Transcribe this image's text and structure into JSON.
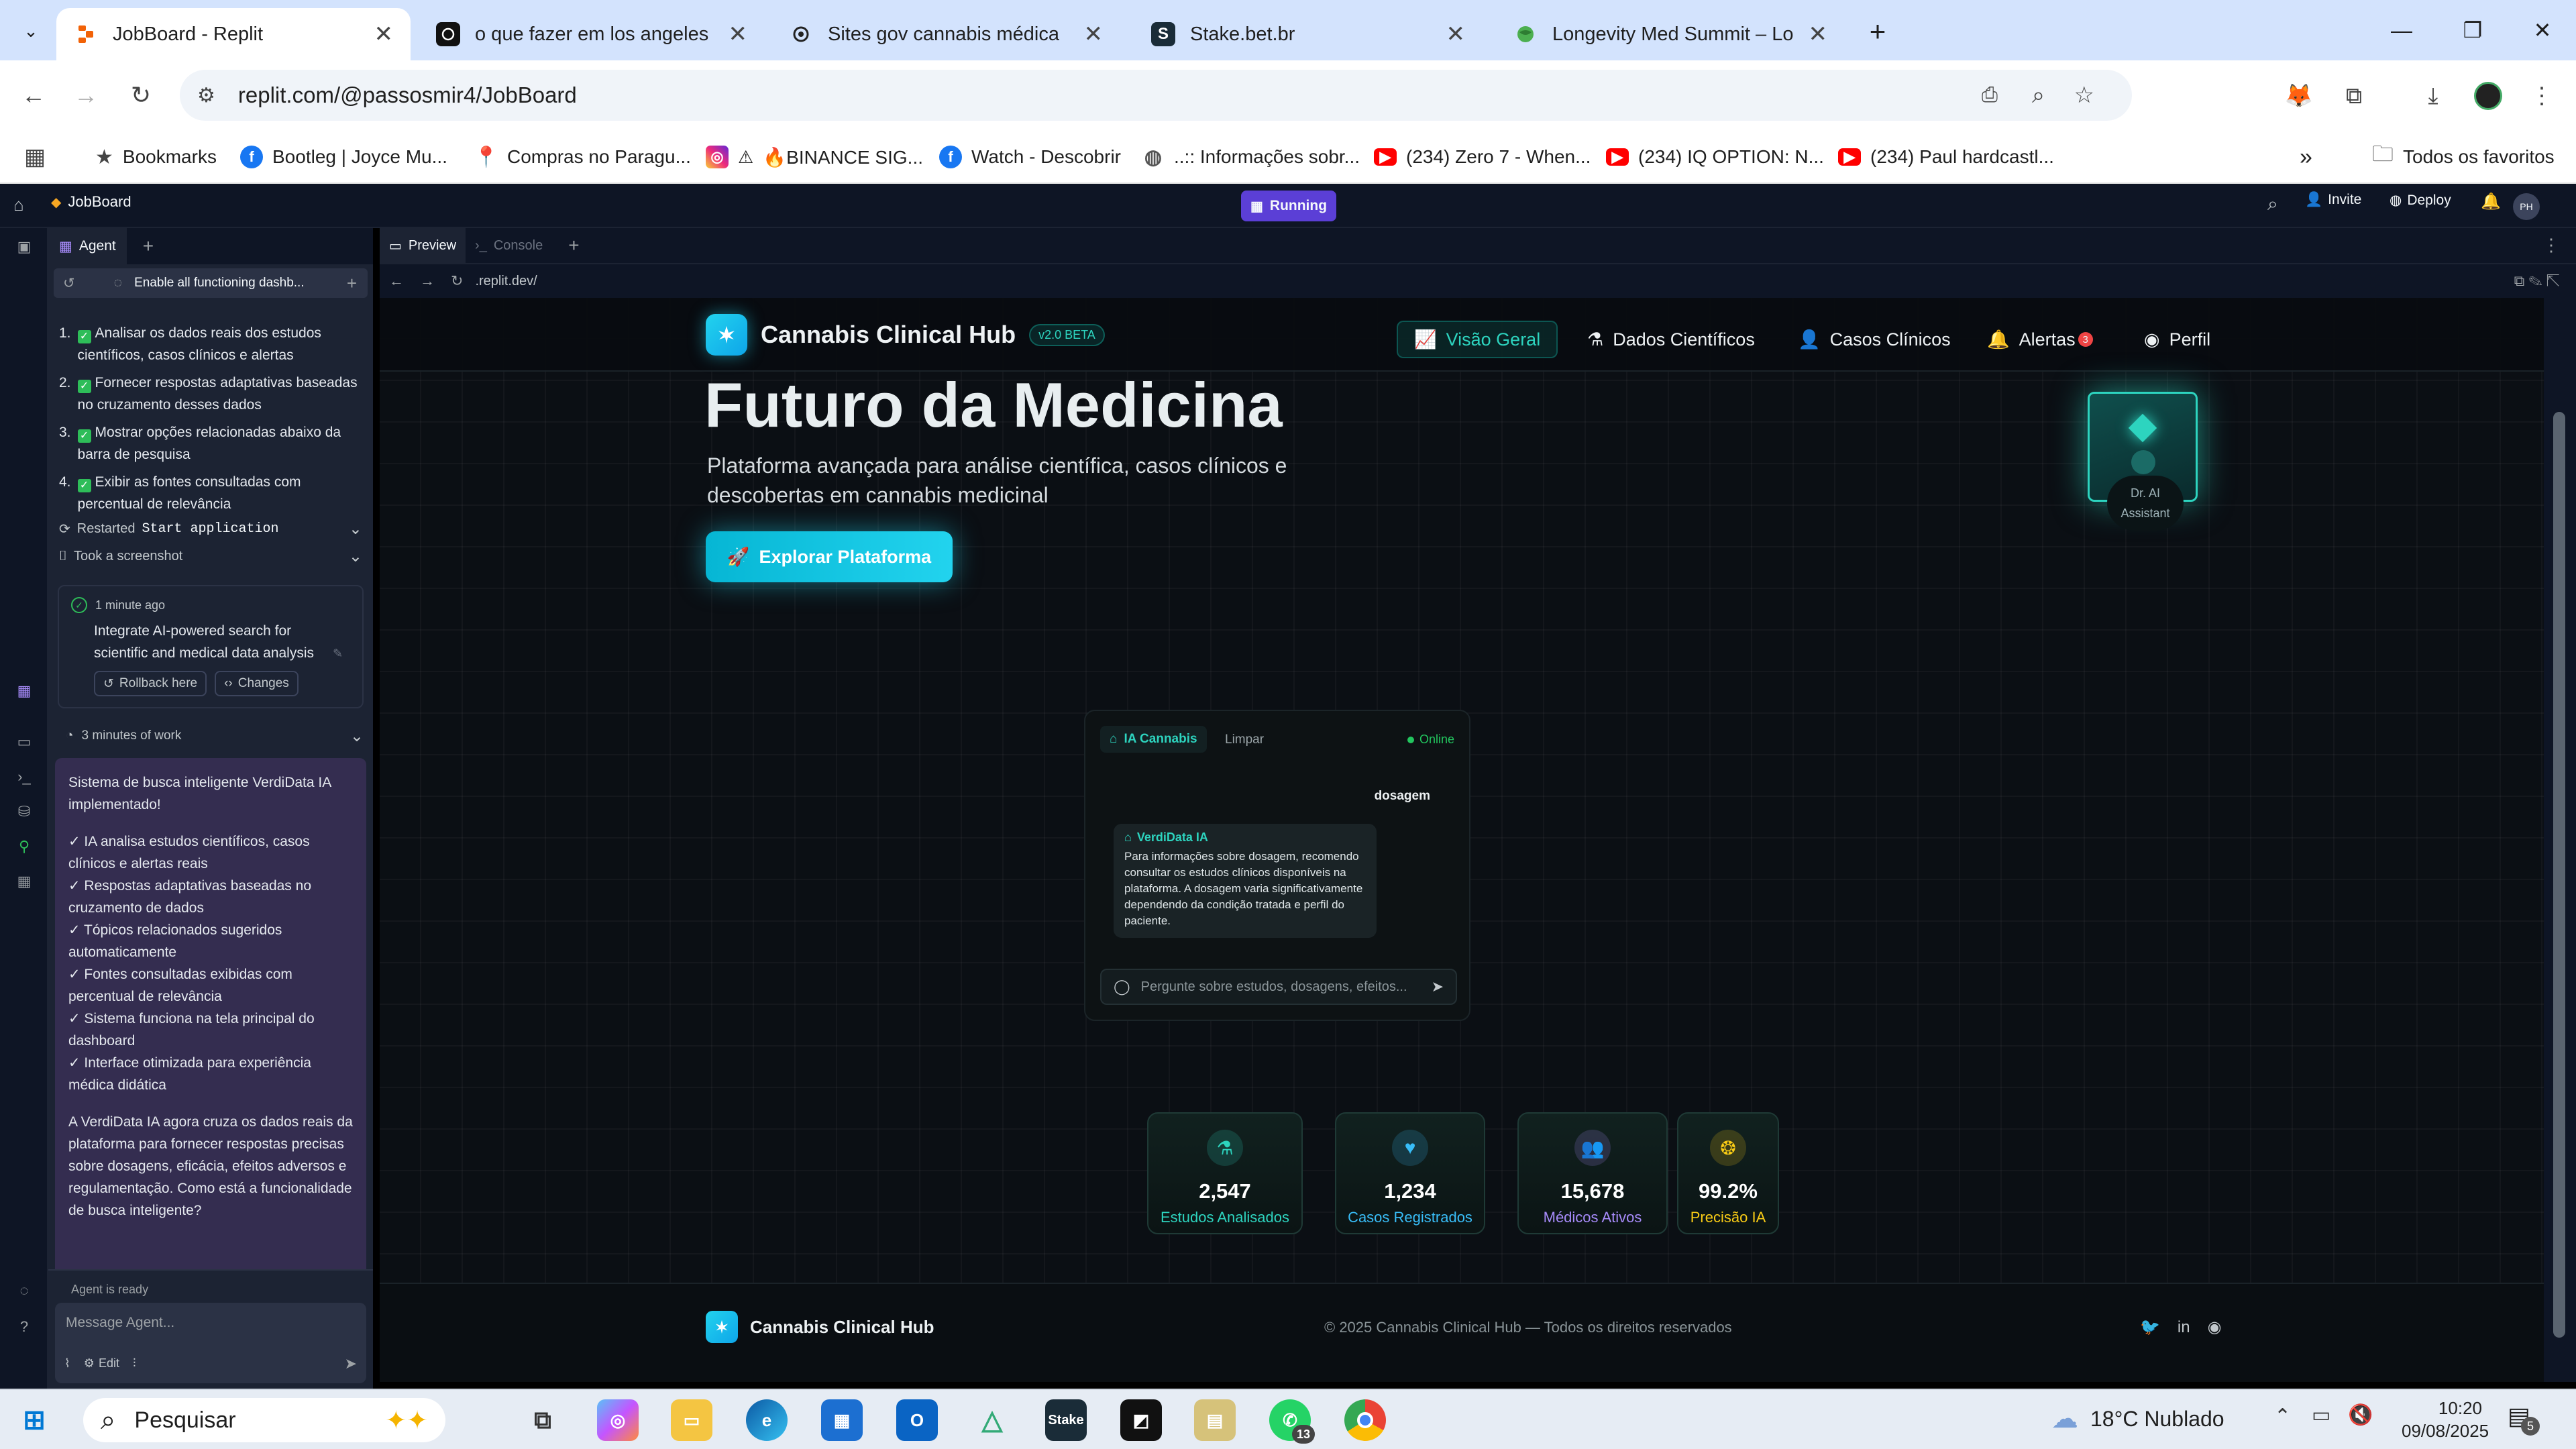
{
  "browser": {
    "tabs": [
      {
        "title": "JobBoard - Replit",
        "active": true
      },
      {
        "title": "o que fazer em los angeles",
        "active": false
      },
      {
        "title": "Sites gov cannabis médica",
        "active": false
      },
      {
        "title": "Stake.bet.br",
        "active": false
      },
      {
        "title": "Longevity Med Summit – Longevity",
        "active": false
      }
    ],
    "url": "replit.com/@passosmir4/JobBoard",
    "bookmarks": [
      "Bookmarks",
      "Bootleg | Joyce Mu...",
      "Compras no Paragu...",
      "🔥BINANCE SIG...",
      "Watch - Descobrir",
      "..:: Informações sobr...",
      "(234) Zero 7 - When...",
      "(234) IQ OPTION: N...",
      "(234) Paul hardcastl..."
    ],
    "all_bookmarks": "Todos os favoritos"
  },
  "replit": {
    "project": "JobBoard",
    "status": "Running",
    "invite": "Invite",
    "deploy": "Deploy",
    "avatar_initials": "PH",
    "agent_tab": "Agent",
    "thread_title": "Enable all functioning dashb...",
    "checklist": [
      "Analisar os dados reais dos estudos científicos, casos clínicos e alertas",
      "Fornecer respostas adaptativas baseadas no cruzamento desses dados",
      "Mostrar opções relacionadas abaixo da barra de pesquisa",
      "Exibir as fontes consultadas com percentual de relevância"
    ],
    "restarted_prefix": "Restarted",
    "restarted_cmd": "Start application",
    "screenshot_label": "Took a screenshot",
    "checkpoint": {
      "time": "1 minute ago",
      "text": "Integrate AI-powered search for scientific and medical data analysis",
      "rollback": "Rollback here",
      "changes": "Changes"
    },
    "work_time": "3 minutes of work",
    "message": {
      "intro": "Sistema de busca inteligente VerdiData IA implementado!",
      "bullets": [
        "✓ IA analisa estudos científicos, casos clínicos e alertas reais",
        "✓ Respostas adaptativas baseadas no cruzamento de dados",
        "✓ Tópicos relacionados sugeridos automaticamente",
        "✓ Fontes consultadas exibidas com percentual de relevância",
        "✓ Sistema funciona na tela principal do dashboard",
        "✓ Interface otimizada para experiência médica didática"
      ],
      "outro": "A VerdiData IA agora cruza os dados reais da plataforma para fornecer respostas precisas sobre dosagens, eficácia, efeitos adversos e regulamentação. Como está a funcionalidade de busca inteligente?"
    },
    "agent_ready": "Agent is ready",
    "message_placeholder": "Message Agent...",
    "edit_label": "Edit",
    "workspace_tabs": [
      "Preview",
      "Console"
    ],
    "preview_url": ".replit.dev/"
  },
  "site": {
    "brand": "Cannabis Clinical Hub",
    "version": "v2.0 BETA",
    "nav": [
      {
        "label": "Visão Geral",
        "icon": "chart-line-icon",
        "active": true
      },
      {
        "label": "Dados Científicos",
        "icon": "flask-icon",
        "active": false
      },
      {
        "label": "Casos Clínicos",
        "icon": "user-icon",
        "active": false
      },
      {
        "label": "Alertas",
        "icon": "bell-icon",
        "active": false,
        "badge": "3"
      },
      {
        "label": "Perfil",
        "icon": "user-circle-icon",
        "active": false
      }
    ],
    "hero_title": "Futuro da Medicina",
    "hero_subtitle_1": "Plataforma avançada para análise científica, casos clínicos e",
    "hero_subtitle_2": "descobertas em cannabis medicinal",
    "cta": "Explorar Plataforma",
    "assistant_line1": "Dr. AI",
    "assistant_line2": "Assistant",
    "chat": {
      "tab": "IA Cannabis",
      "clear": "Limpar",
      "status": "Online",
      "user_message": "dosagem",
      "bot_name": "VerdiData IA",
      "bot_message": "Para informações sobre dosagem, recomendo consultar os estudos clínicos disponíveis na plataforma. A dosagem varia significativamente dependendo da condição tratada e perfil do paciente.",
      "placeholder": "Pergunte sobre estudos, dosagens, efeitos..."
    },
    "stats": [
      {
        "value": "2,547",
        "label": "Estudos Analisados",
        "color": "#2dd4bf",
        "icon": "flask-icon"
      },
      {
        "value": "1,234",
        "label": "Casos Registrados",
        "color": "#38bdf8",
        "icon": "heart-icon"
      },
      {
        "value": "15,678",
        "label": "Médicos Ativos",
        "color": "#a78bfa",
        "icon": "users-icon"
      },
      {
        "value": "99.2%",
        "label": "Precisão IA",
        "color": "#facc15",
        "icon": "brain-icon"
      }
    ],
    "footer_brand": "Cannabis Clinical Hub",
    "footer_copy": "© 2025 Cannabis Clinical Hub — Todos os direitos reservados"
  },
  "taskbar": {
    "search": "Pesquisar",
    "weather": "18°C  Nublado",
    "time": "10:20",
    "date": "09/08/2025",
    "whatsapp_badge": "13",
    "notif_badge": "5"
  },
  "colors": {
    "accent": "#14b8a6",
    "replit_bg": "#0e1525",
    "running": "#5b3fd6",
    "chrome_tabbar": "#d3e3fd"
  }
}
